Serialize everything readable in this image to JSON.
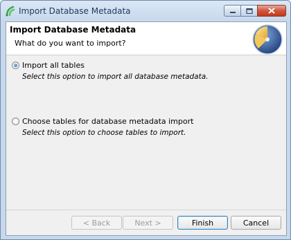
{
  "window": {
    "title": "Import Database Metadata"
  },
  "header": {
    "title": "Import Database Metadata",
    "subtitle": "What do you want to import?",
    "icon": "database-wizard-icon"
  },
  "options": [
    {
      "label": "Import all tables",
      "description": "Select this option to import all database metadata.",
      "selected": true
    },
    {
      "label": "Choose tables for database metadata import",
      "description": "Select this option to choose tables to import.",
      "selected": false
    }
  ],
  "buttons": {
    "back": "< Back",
    "next": "Next >",
    "finish": "Finish",
    "cancel": "Cancel"
  },
  "colors": {
    "accent": "#1d5fae",
    "close": "#c1391e"
  }
}
